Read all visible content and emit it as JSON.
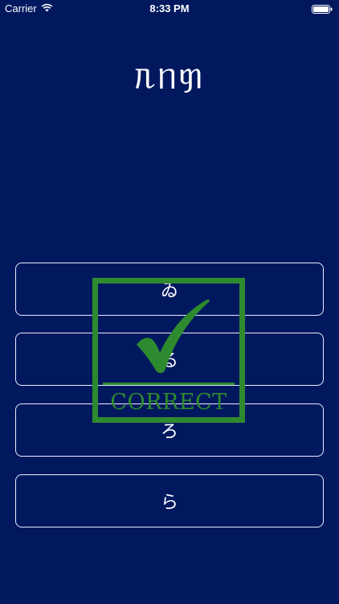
{
  "status_bar": {
    "carrier": "Carrier",
    "time": "8:33 PM",
    "wifi_icon": "wifi-icon",
    "battery_icon": "battery-icon"
  },
  "prompt": {
    "word": "ᥰᥒᥞ"
  },
  "answers": [
    {
      "label": "ゐ"
    },
    {
      "label": "る"
    },
    {
      "label": "ろ"
    },
    {
      "label": "ら"
    }
  ],
  "feedback": {
    "label": "CORRECT",
    "icon": "check-mark-icon",
    "color": "#2e8a2e"
  },
  "colors": {
    "background": "#01185f",
    "button_border": "#e8ecff",
    "text": "#ffffff"
  }
}
